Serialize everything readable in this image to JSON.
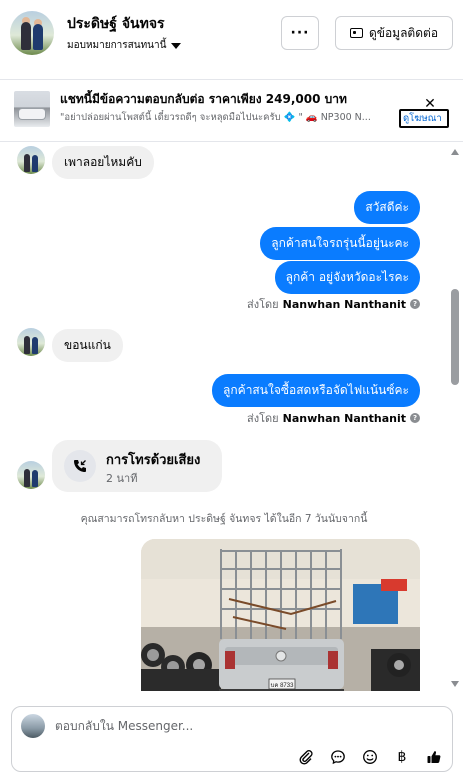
{
  "header": {
    "name": "ประดิษฐ์ จันทจร",
    "assign_label": "มอบหมายการสนทนานี้",
    "more_label": "···",
    "contact_button": "ดูข้อมูลติดต่อ"
  },
  "ad": {
    "title": "แชทนี้มีข้อความตอบกลับต่อ ราคาเพียง 249,000 บาท",
    "text": "\"อย่าปล่อยผ่านโพสต์นี้ เดี๋ยวรถดีๆ จะหลุดมือไปนะครับ 💠 \" 🚗 NP300 N...",
    "link": "ดูโฆษณา",
    "close": "✕"
  },
  "messages": {
    "m1": "เพาลอยไหมคับ",
    "m2": "สวัสดีค่ะ",
    "m3": "ลูกค้าสนใจรถรุ่นนี้อยู่นะคะ",
    "m4": "ลูกค้า อยู่จังหวัดอะไรคะ",
    "sent_by_prefix": "ส่งโดย",
    "sent_by_name": "Nanwhan Nanthanit",
    "m5": "ขอนแก่น",
    "m6": "ลูกค้าสนใจซื้อสดหรือจัดไฟแน้นซ์คะ",
    "call_title": "การโทรด้วยเสียง",
    "call_duration": "2 นาที",
    "notice": "คุณสามารถโทรกลับหา ประดิษฐ์ จันทจร ได้ในอีก 7 วันนับจากนี้"
  },
  "photo": {
    "plate": "บค 8733"
  },
  "composer": {
    "placeholder": "ตอบกลับใน Messenger..."
  },
  "icons": {
    "attach": "paperclip-icon",
    "chat": "chat-bubble-icon",
    "emoji": "emoji-icon",
    "baht": "฿",
    "like": "thumbs-up-icon"
  },
  "colors": {
    "outgoing_bubble": "#0a7cff",
    "incoming_bubble": "#f0f0f0",
    "link": "#0064d1"
  }
}
